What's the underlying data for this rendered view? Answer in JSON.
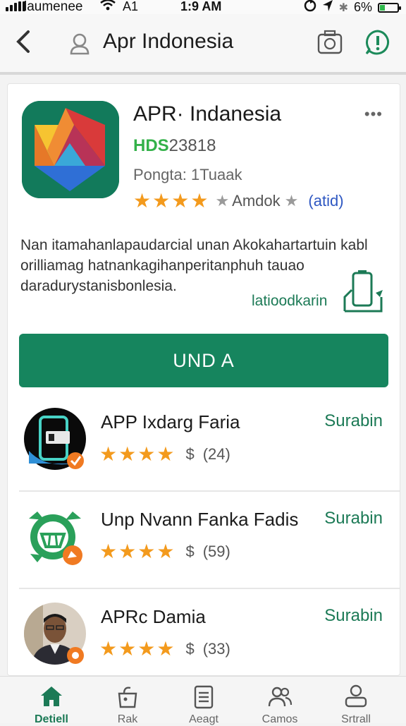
{
  "status_bar": {
    "carrier": "laumenee",
    "network": "A1",
    "time": "1:9 AM",
    "battery": "6%",
    "battery_level": 0.3,
    "icons": [
      "signal-icon",
      "wifi-icon",
      "sync-icon",
      "location-icon",
      "bluetooth-icon",
      "battery-icon"
    ]
  },
  "appbar": {
    "title": "Apr Indonesia",
    "icons": [
      "back-icon",
      "profile-icon",
      "camera-icon",
      "alert-icon"
    ]
  },
  "app": {
    "name": "APR· Indanesia",
    "id_prefix": "HDS",
    "id_number": "23818",
    "meta": "Pongta: 1Tuaak",
    "rating_stars": 4,
    "rating_text": "Amdok",
    "rated_label": "(atid)",
    "more_label": "•••",
    "description": "Nan itamahanlapaudarcial unan Akokahartartuin kabl orilliamag hatnankagihanperitanphuh tauao daradurystanisbonlesia.",
    "link_label": "latioodkarin",
    "button_label": "UND A"
  },
  "list": [
    {
      "title": "APP Ixdarg Faria",
      "action": "Surabin",
      "stars": 4,
      "price": "$",
      "count": "(24)",
      "icon": "phone-app-icon"
    },
    {
      "title": "Unp Nvann Fanka Fadis",
      "action": "Surabin",
      "stars": 4,
      "price": "$",
      "count": "(59)",
      "icon": "basket-app-icon"
    },
    {
      "title": "APRc Damia",
      "action": "Surabin",
      "stars": 4,
      "price": "$",
      "count": "(33)",
      "icon": "person-avatar"
    }
  ],
  "bottom_nav": [
    {
      "label": "Detiell",
      "icon": "home-icon",
      "active": true
    },
    {
      "label": "Rak",
      "icon": "bag-icon",
      "active": false
    },
    {
      "label": "Aeagt",
      "icon": "list-icon",
      "active": false
    },
    {
      "label": "Camos",
      "icon": "people-icon",
      "active": false
    },
    {
      "label": "Srtrall",
      "icon": "user-icon",
      "active": false
    }
  ],
  "colors": {
    "accent": "#16855e",
    "accent_text": "#1c7a56",
    "star": "#f39a1d",
    "id_green": "#33b149",
    "rated_blue": "#2e57c2"
  }
}
